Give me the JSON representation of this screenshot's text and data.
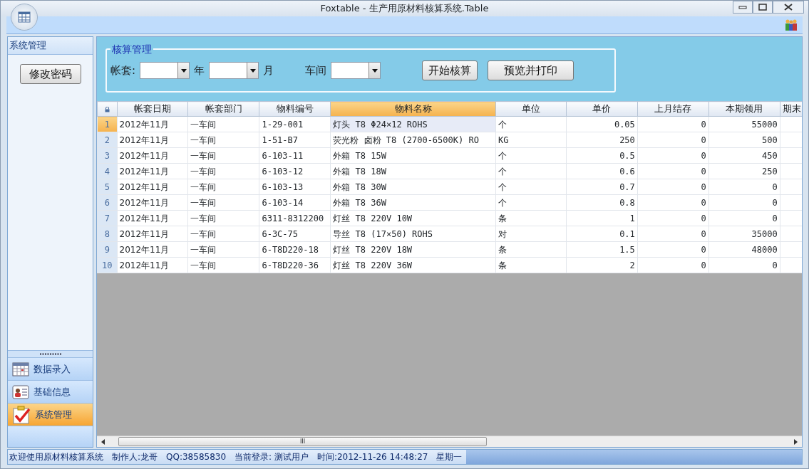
{
  "window": {
    "title": "Foxtable - 生产用原材料核算系统.Table"
  },
  "sidebar": {
    "header": "系统管理",
    "button": "修改密码",
    "items": [
      {
        "label": "数据录入",
        "kind": "calendar",
        "selected": false
      },
      {
        "label": "基础信息",
        "kind": "card",
        "selected": false
      },
      {
        "label": "系统管理",
        "kind": "checklist",
        "selected": true
      }
    ]
  },
  "filter": {
    "legend": "核算管理",
    "fields": [
      {
        "label": "帐套:",
        "unit": "年"
      },
      {
        "unit": "月"
      },
      {
        "label": "车间"
      }
    ],
    "buttons": [
      "开始核算",
      "预览并打印"
    ]
  },
  "table": {
    "columns": [
      {
        "label": "帐套日期",
        "kind": "text",
        "selected": false
      },
      {
        "label": "帐套部门",
        "kind": "text",
        "selected": false
      },
      {
        "label": "物料编号",
        "kind": "text",
        "selected": false
      },
      {
        "label": "物料名称",
        "kind": "text",
        "selected": true
      },
      {
        "label": "单位",
        "kind": "text",
        "selected": false
      },
      {
        "label": "单价",
        "kind": "number",
        "selected": false
      },
      {
        "label": "上月结存",
        "kind": "number",
        "selected": false
      },
      {
        "label": "本期领用",
        "kind": "number",
        "selected": false
      },
      {
        "label": "期末",
        "kind": "text",
        "selected": false
      }
    ],
    "rows": [
      {
        "number": "1",
        "selected": true,
        "cells": [
          "2012年11月",
          "一车间",
          "1-29-001",
          "灯头 T8 Φ24×12 ROHS",
          "个",
          "0.05",
          "0",
          "55000",
          ""
        ]
      },
      {
        "number": "2",
        "selected": false,
        "cells": [
          "2012年11月",
          "一车间",
          "1-51-B7",
          "荧光粉 卤粉 T8 (2700-6500K) RO",
          "KG",
          "250",
          "0",
          "500",
          ""
        ]
      },
      {
        "number": "3",
        "selected": false,
        "cells": [
          "2012年11月",
          "一车间",
          "6-103-11",
          "外箱 T8 15W",
          "个",
          "0.5",
          "0",
          "450",
          ""
        ]
      },
      {
        "number": "4",
        "selected": false,
        "cells": [
          "2012年11月",
          "一车间",
          "6-103-12",
          "外箱 T8 18W",
          "个",
          "0.6",
          "0",
          "250",
          ""
        ]
      },
      {
        "number": "5",
        "selected": false,
        "cells": [
          "2012年11月",
          "一车间",
          "6-103-13",
          "外箱 T8 30W",
          "个",
          "0.7",
          "0",
          "0",
          ""
        ]
      },
      {
        "number": "6",
        "selected": false,
        "cells": [
          "2012年11月",
          "一车间",
          "6-103-14",
          "外箱 T8 36W",
          "个",
          "0.8",
          "0",
          "0",
          ""
        ]
      },
      {
        "number": "7",
        "selected": false,
        "cells": [
          "2012年11月",
          "一车间",
          "6311-8312200",
          "灯丝 T8 220V 10W",
          "条",
          "1",
          "0",
          "0",
          ""
        ]
      },
      {
        "number": "8",
        "selected": false,
        "cells": [
          "2012年11月",
          "一车间",
          "6-3C-75",
          "导丝 T8 (17×50) ROHS",
          "对",
          "0.1",
          "0",
          "35000",
          ""
        ]
      },
      {
        "number": "9",
        "selected": false,
        "cells": [
          "2012年11月",
          "一车间",
          "6-T8D220-18",
          "灯丝 T8 220V 18W",
          "条",
          "1.5",
          "0",
          "48000",
          ""
        ]
      },
      {
        "number": "10",
        "selected": false,
        "cells": [
          "2012年11月",
          "一车间",
          "6-T8D220-36",
          "灯丝 T8 220V 36W",
          "条",
          "2",
          "0",
          "0",
          ""
        ]
      }
    ]
  },
  "scrollbar_grip": "III",
  "status_bar": [
    "欢迎使用原材料核算系统",
    "制作人:龙哥",
    "QQ:38585830",
    "当前登录: 测试用户",
    "时间:2012-11-26 14:48:27",
    "星期一"
  ]
}
